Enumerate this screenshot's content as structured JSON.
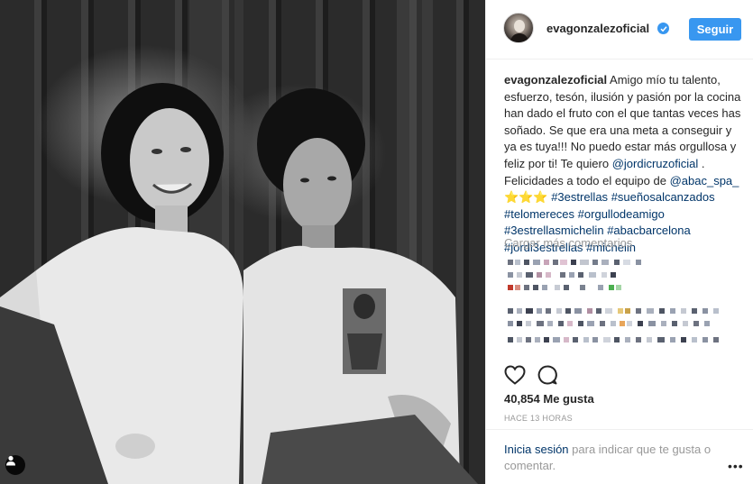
{
  "header": {
    "username": "evagonzalezoficial",
    "verified_icon": "verified-badge-icon",
    "follow_label": "Seguir"
  },
  "caption": {
    "username": "evagonzalezoficial",
    "text_1": " Amigo mío tu talento, esfuerzo, tesón, ilusión y pasión por la cocina han dado el fruto con el que tantas veces has soñado. Se que era una meta a conseguir y ya es tuya!!! No puedo estar más orgullosa y feliz por ti! Te quiero ",
    "mention_1": "@jordicruzoficial",
    "text_2": " . Felicidades a todo el equipo de ",
    "mention_2": "@abac_spa_",
    "stars": " ⭐⭐⭐",
    "hashtags": [
      "#3estrellas",
      "#sueñosalcanzados",
      "#telomereces",
      "#orgullodeamigo",
      "#3estrellasmichelin",
      "#abacbarcelona",
      "#jordi3estrellas",
      "#michelin"
    ]
  },
  "comments": {
    "load_more": "Cargar más comentarios"
  },
  "actions": {
    "like_icon": "heart-icon",
    "comment_icon": "comment-bubble-icon"
  },
  "likes": "40,854 Me gusta",
  "timestamp": "HACE 13 HORAS",
  "login": {
    "link": "Inicia sesión",
    "text": " para indicar que te gusta o comentar.",
    "more_icon": "more-options-icon"
  },
  "colors": {
    "accent": "#3897f0",
    "link": "#003569",
    "muted": "#999999"
  }
}
